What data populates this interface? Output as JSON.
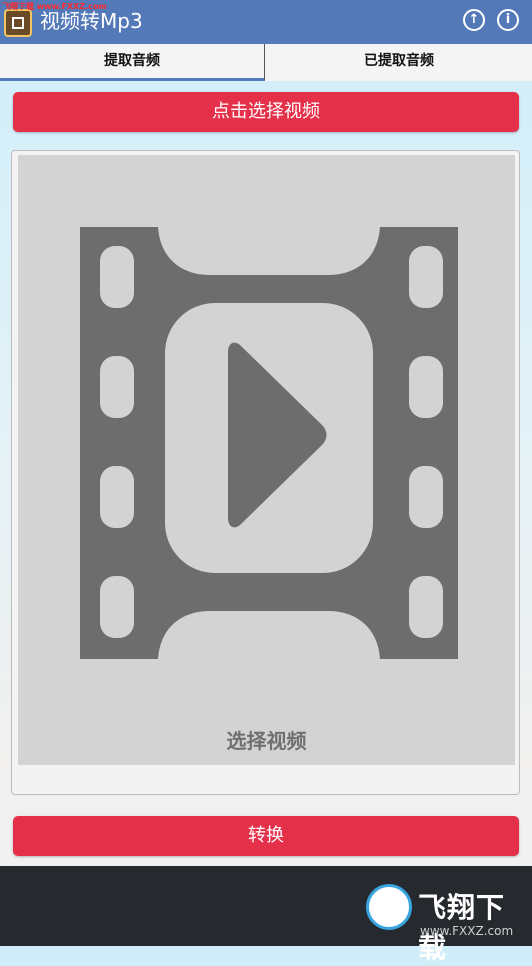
{
  "appbar": {
    "title": "视频转Mp3",
    "watermark": "飞翔下载 www.FXXZ.com",
    "upload_icon": "arrow-up-circle-icon",
    "info_icon": "info-circle-icon",
    "color": "#5479b9"
  },
  "tabs": [
    {
      "label": "提取音频",
      "selected": true
    },
    {
      "label": "已提取音频",
      "selected": false
    }
  ],
  "select_video_button": "点击选择视频",
  "preview": {
    "icon": "film-play-icon",
    "label": "选择视频"
  },
  "convert_button": "转换",
  "watermark_footer": {
    "brand": "飞翔下载",
    "url": "www.FXXZ.com"
  },
  "colors": {
    "accent_red": "#e5304a",
    "bottom_bar": "#262a2e"
  }
}
